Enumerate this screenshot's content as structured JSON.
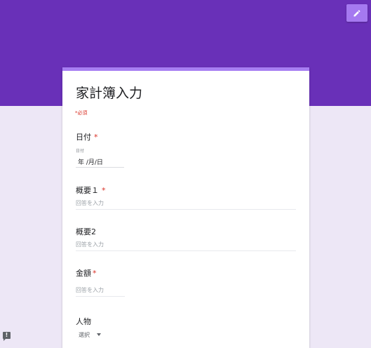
{
  "header": {
    "band_color": "#6930b8",
    "edit_icon": "pencil-icon",
    "edit_button_color": "#a579f0"
  },
  "form": {
    "title": "家計簿入力",
    "required_note": "*必須",
    "accent_color": "#a77ef2",
    "questions": [
      {
        "label": "日付",
        "required": true,
        "caption": "日付",
        "value": "年 /月/日"
      },
      {
        "label": "概要１",
        "required": true,
        "placeholder": "回答を入力"
      },
      {
        "label": "概要2",
        "required": false,
        "placeholder": "回答を入力"
      },
      {
        "label": "金額",
        "required": true,
        "placeholder": "回答を入力"
      },
      {
        "label": "人物",
        "required": false,
        "select_value": "選択"
      }
    ]
  },
  "footer": {
    "feedback_icon": "feedback-icon",
    "feedback_glyph": "!"
  }
}
